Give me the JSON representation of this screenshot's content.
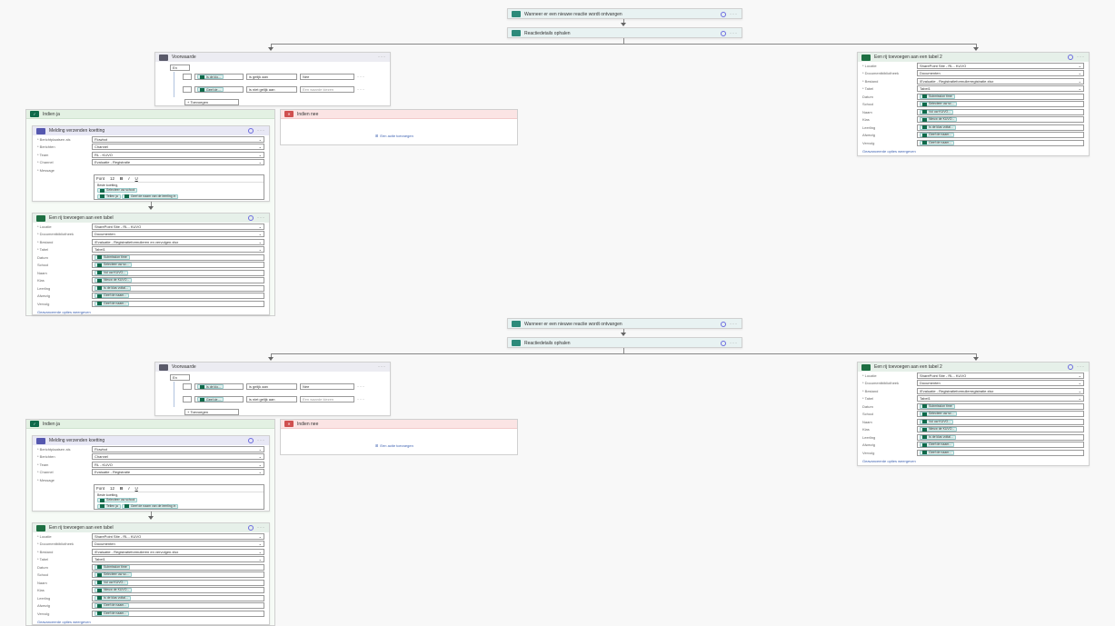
{
  "trigger": {
    "label": "Wanneer er een nieuwe reactie wordt ontvangen"
  },
  "details": {
    "label": "Reactiedetails ophalen"
  },
  "condition": {
    "title": "Voorwaarde",
    "group": "En",
    "row1": {
      "left": "Is de klo...",
      "op": "is gelijk aan",
      "right": "Nee"
    },
    "row2": {
      "left": "Geef de ...",
      "op": "is niet gelijk aan",
      "right": "Een waarde kiezen"
    },
    "add": "Toevoegen"
  },
  "yes": {
    "title": "Indien ja"
  },
  "no": {
    "title": "Indien nee",
    "add_action": "Een actie toevoegen"
  },
  "teams": {
    "title": "Melding verzenden koetting",
    "fields": [
      {
        "label": "* Berichtplaatsen als",
        "value": "Flowbot"
      },
      {
        "label": "* Berichten",
        "value": "Channel"
      },
      {
        "label": "* Team",
        "value": "RL - KUVO"
      },
      {
        "label": "* Channel",
        "value": "Evaluatie - Registratie"
      },
      {
        "label": "* Message",
        "value": ""
      }
    ],
    "toolbar": [
      "Font",
      "12",
      "B",
      "I",
      "U"
    ],
    "message_lines": [
      "Beste koetting,",
      "Melding voor het Leerling:",
      "Voor klachten: Tellen ja"
    ],
    "message_chips": [
      "Selecteer uw school",
      "Tellen ja",
      "Geef de naam van de leerling in"
    ]
  },
  "excel_left": {
    "title": "Een rij toevoegen aan een tabel",
    "fields": [
      {
        "label": "* Locatie",
        "value": "SharePoint Site - RL - KUVO"
      },
      {
        "label": "* Documentbibliotheek",
        "value": "Documenten"
      },
      {
        "label": "* Bestand",
        "value": "/Evaluatie - Registratieformulieren en vervolgen.xlsx"
      },
      {
        "label": "* Tabel",
        "value": "Tabel1"
      },
      {
        "label": "Datum",
        "value": "Submission time"
      },
      {
        "label": "School",
        "value": "Selecteer uw sc..."
      },
      {
        "label": "Naam",
        "value": "Vul uw KUVO..."
      },
      {
        "label": "Klas",
        "value": "Nieuw de KUVO..."
      },
      {
        "label": "Leerling",
        "value": "Is de klas voltal..."
      },
      {
        "label": "Afwezig",
        "value": "Geef de naam..."
      },
      {
        "label": "Vervolg",
        "value": "Geef de naam..."
      }
    ],
    "advanced": "Geavanceerde opties weergeven"
  },
  "excel_right": {
    "title": "Een rij toevoegen aan een tabel 2",
    "fields": [
      {
        "label": "* Locatie",
        "value": "SharePoint Site - RL - KUVO"
      },
      {
        "label": "* Documentbibliotheek",
        "value": "Documenten"
      },
      {
        "label": "* Bestand",
        "value": "/Evaluatie - Registratieformulierregistratie.xlsx"
      },
      {
        "label": "* Tabel",
        "value": "Tabel1"
      },
      {
        "label": "Datum",
        "value": "Submission time"
      },
      {
        "label": "School",
        "value": "Selecteer uw sc..."
      },
      {
        "label": "Naam",
        "value": "Vul uw KUVO..."
      },
      {
        "label": "Klas",
        "value": "Nieuw de KUVO..."
      },
      {
        "label": "Leerling",
        "value": "Is de klas voltal..."
      },
      {
        "label": "Afwezig",
        "value": "Geef de naam..."
      },
      {
        "label": "Vervolg",
        "value": "Geef de naam..."
      }
    ],
    "advanced": "Geavanceerde opties weergeven"
  },
  "colors": {
    "excel": "#1d6f42",
    "teams": "#5558af",
    "yes_bg": "#e3f1e3",
    "no_bg": "#fbe4e4"
  }
}
